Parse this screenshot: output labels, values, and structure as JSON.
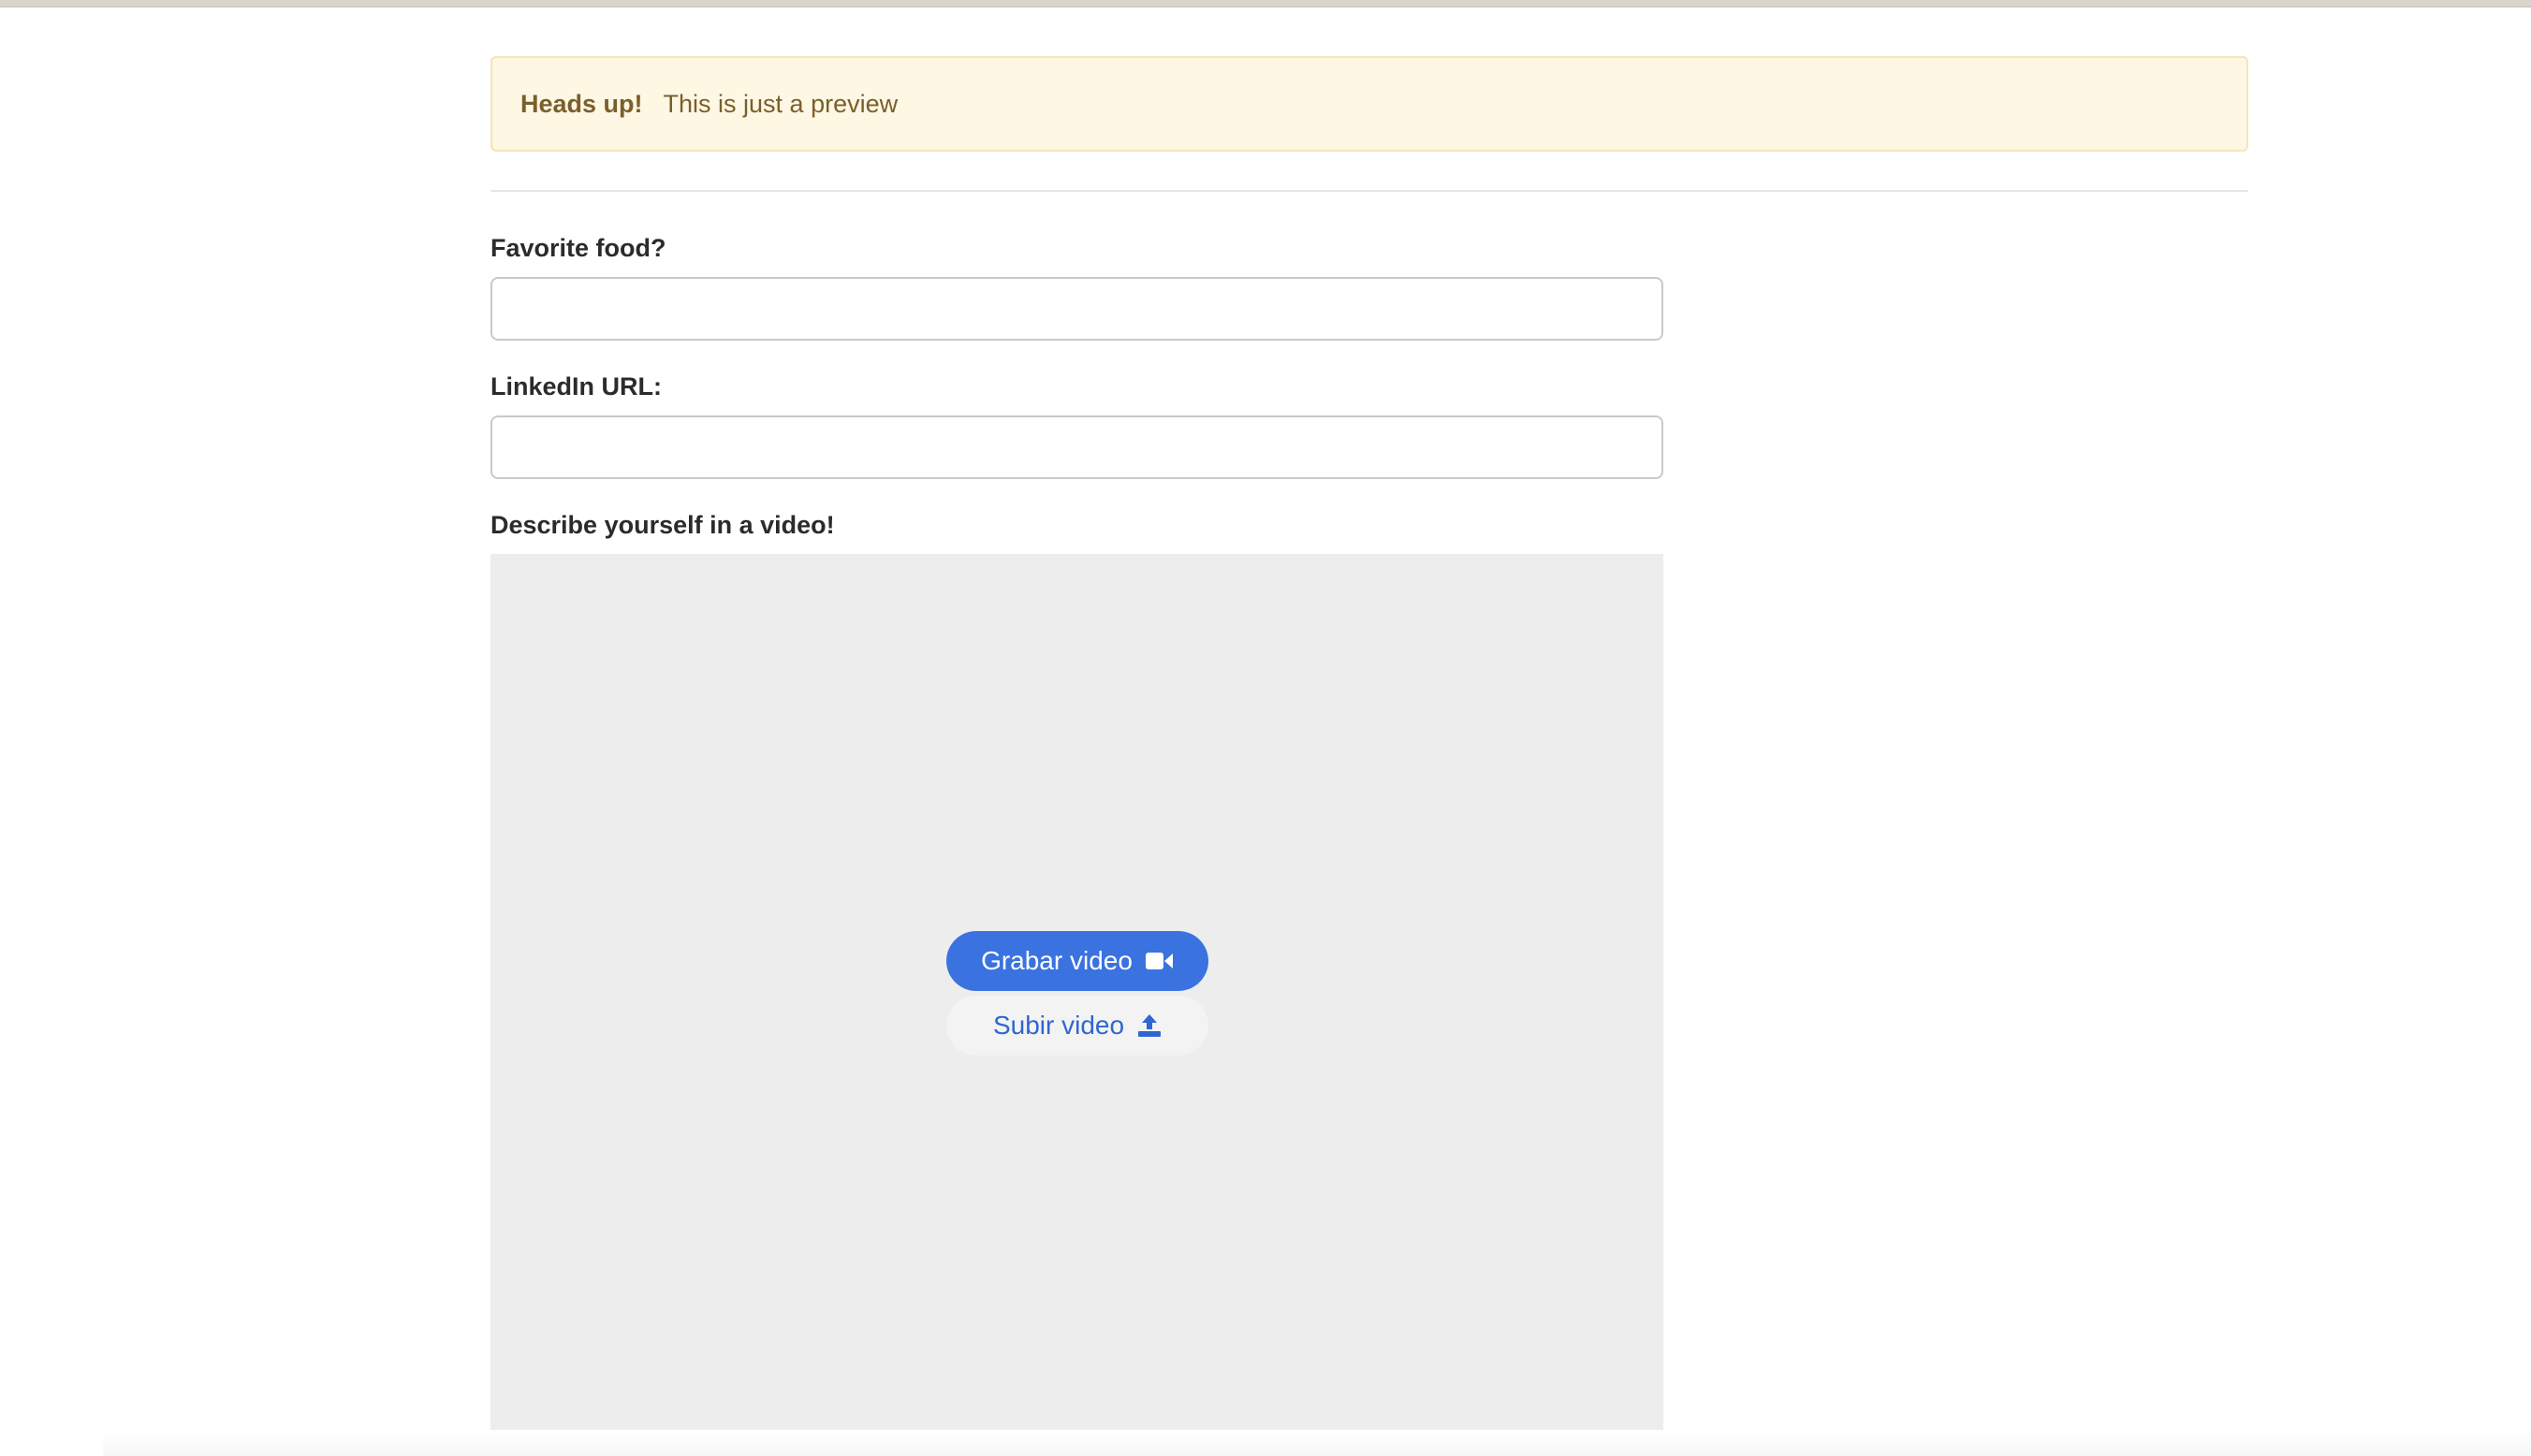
{
  "alert": {
    "strong": "Heads up!",
    "message": "This is just a preview"
  },
  "form": {
    "food_label": "Favorite food?",
    "food_value": "",
    "linkedin_label": "LinkedIn URL:",
    "linkedin_value": "",
    "video_label": "Describe yourself in a video!"
  },
  "video": {
    "record_label": "Grabar video",
    "upload_label": "Subir video",
    "record_icon": "video-camera-icon",
    "upload_icon": "upload-icon"
  },
  "colors": {
    "primary": "#3a72e0",
    "alert_bg": "#fdf7e3",
    "alert_text": "#7a5f2c"
  }
}
